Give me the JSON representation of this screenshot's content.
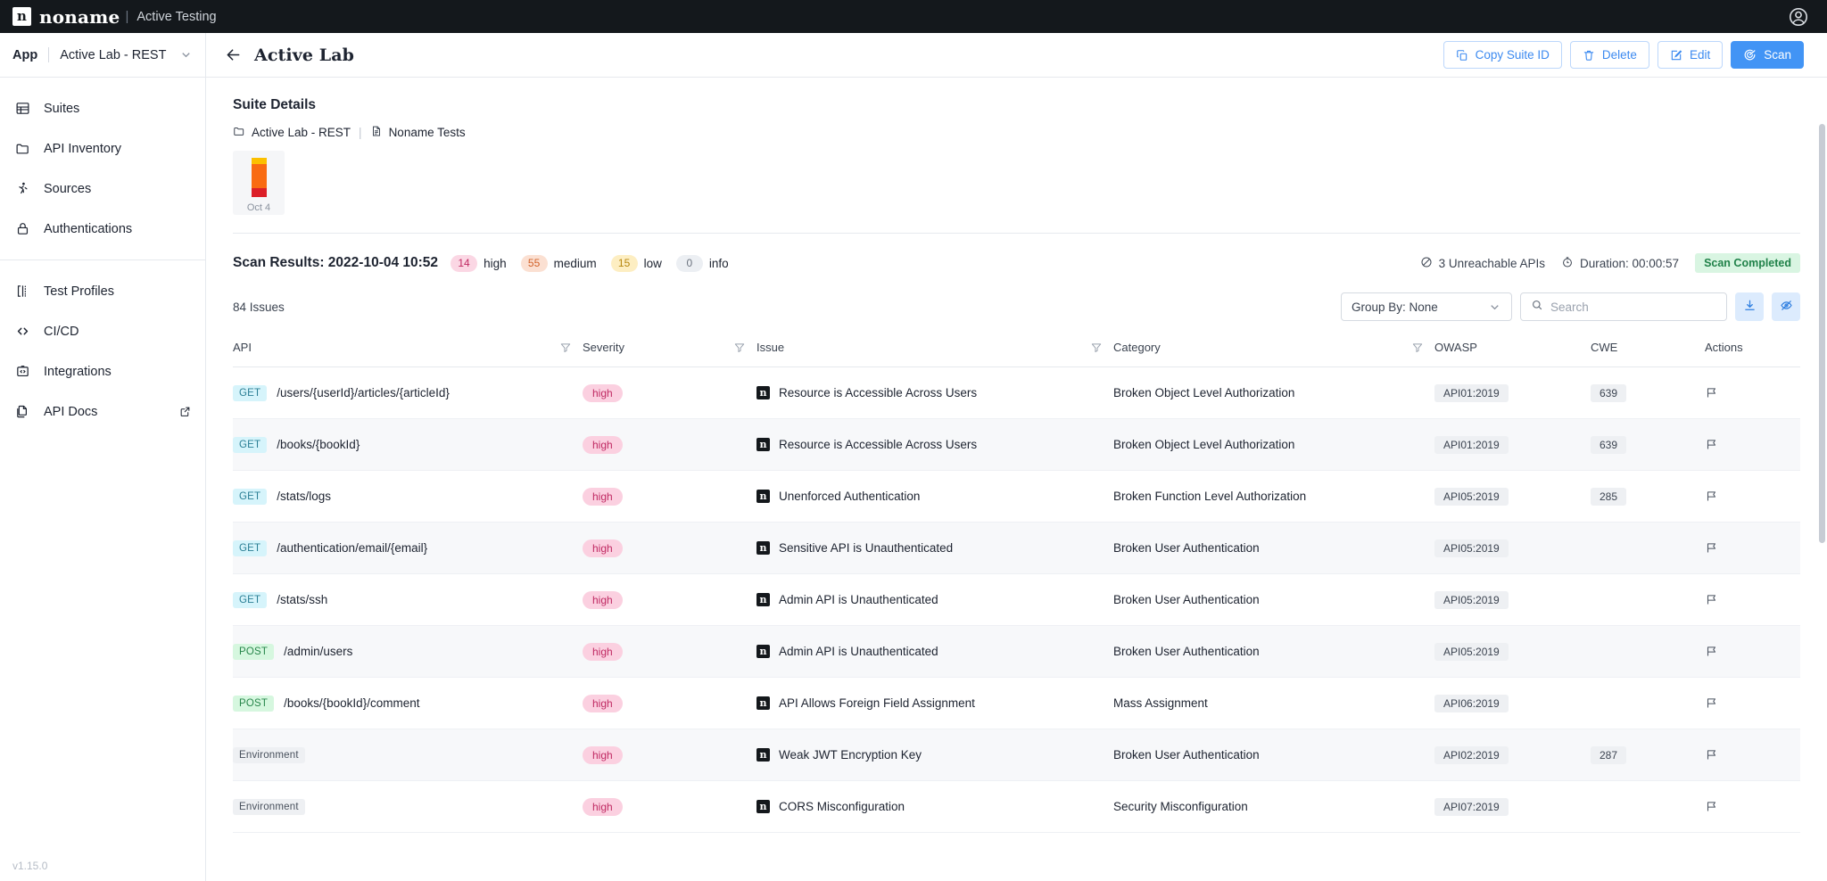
{
  "topbar": {
    "brand_mark": "n",
    "brand_name": "noname",
    "separator": "|",
    "subtitle": "Active Testing",
    "avatar_icon": "user-circle-icon"
  },
  "sidebar": {
    "app_label": "App",
    "app_value": "Active Lab - REST",
    "version": "v1.15.0",
    "groups": [
      {
        "items": [
          {
            "label": "Suites",
            "icon": "suites-icon"
          },
          {
            "label": "API Inventory",
            "icon": "folder-icon"
          },
          {
            "label": "Sources",
            "icon": "person-walking-icon"
          },
          {
            "label": "Authentications",
            "icon": "lock-icon"
          }
        ]
      },
      {
        "items": [
          {
            "label": "Test Profiles",
            "icon": "test-profiles-icon"
          },
          {
            "label": "CI/CD",
            "icon": "code-brackets-icon"
          },
          {
            "label": "Integrations",
            "icon": "integrations-icon"
          },
          {
            "label": "API Docs",
            "icon": "documents-icon",
            "external": true
          }
        ]
      }
    ]
  },
  "page": {
    "back_icon": "arrow-left-icon",
    "title": "Active Lab",
    "actions": [
      {
        "label": "Copy Suite ID",
        "icon": "copy-icon",
        "primary": false
      },
      {
        "label": "Delete",
        "icon": "trash-icon",
        "primary": false
      },
      {
        "label": "Edit",
        "icon": "pencil-square-icon",
        "primary": false
      },
      {
        "label": "Scan",
        "icon": "scan-target-icon",
        "primary": true
      }
    ]
  },
  "suite_details": {
    "title": "Suite Details",
    "breadcrumb": [
      {
        "label": "Active Lab - REST",
        "icon": "folder-icon"
      },
      {
        "label": "Noname Tests",
        "icon": "document-icon"
      }
    ],
    "breadcrumb_separator": "|",
    "spark": {
      "date": "Oct 4",
      "segments": [
        {
          "name": "low",
          "color": "#fcc000",
          "pct": 16
        },
        {
          "name": "medium",
          "color": "#f96b12",
          "pct": 62
        },
        {
          "name": "high",
          "color": "#dc1f28",
          "pct": 22
        }
      ]
    }
  },
  "scan_results": {
    "title": "Scan Results: 2022-10-04 10:52",
    "severities": [
      {
        "count": "14",
        "label": "high",
        "key": "high"
      },
      {
        "count": "55",
        "label": "medium",
        "key": "medium"
      },
      {
        "count": "15",
        "label": "low",
        "key": "low"
      },
      {
        "count": "0",
        "label": "info",
        "key": "info"
      }
    ],
    "unreachable": "3 Unreachable APIs",
    "unreachable_icon": "no-entry-icon",
    "duration": "Duration: 00:00:57",
    "duration_icon": "stopwatch-icon",
    "status": "Scan Completed",
    "status_color": "#21824a"
  },
  "toolbar": {
    "issues_count": "84 Issues",
    "group_by": "Group By: None",
    "search_placeholder": "Search",
    "search_value": "",
    "search_icon": "search-icon",
    "download_icon": "download-icon",
    "hide_icon": "eye-off-icon"
  },
  "table": {
    "columns": [
      {
        "key": "api",
        "label": "API",
        "filter": true
      },
      {
        "key": "severity",
        "label": "Severity",
        "filter": true
      },
      {
        "key": "issue",
        "label": "Issue",
        "filter": true
      },
      {
        "key": "category",
        "label": "Category",
        "filter": true
      },
      {
        "key": "owasp",
        "label": "OWASP",
        "filter": false
      },
      {
        "key": "cwe",
        "label": "CWE",
        "filter": false
      },
      {
        "key": "actions",
        "label": "Actions",
        "filter": false
      }
    ],
    "rows": [
      {
        "method": "GET",
        "path": "/users/{userId}/articles/{articleId}",
        "severity": "high",
        "issue": "Resource is Accessible Across Users",
        "category": "Broken Object Level Authorization",
        "owasp": "API01:2019",
        "cwe": "639"
      },
      {
        "method": "GET",
        "path": "/books/{bookId}",
        "severity": "high",
        "issue": "Resource is Accessible Across Users",
        "category": "Broken Object Level Authorization",
        "owasp": "API01:2019",
        "cwe": "639"
      },
      {
        "method": "GET",
        "path": "/stats/logs",
        "severity": "high",
        "issue": "Unenforced Authentication",
        "category": "Broken Function Level Authorization",
        "owasp": "API05:2019",
        "cwe": "285"
      },
      {
        "method": "GET",
        "path": "/authentication/email/{email}",
        "severity": "high",
        "issue": "Sensitive API is Unauthenticated",
        "category": "Broken User Authentication",
        "owasp": "API05:2019",
        "cwe": ""
      },
      {
        "method": "GET",
        "path": "/stats/ssh",
        "severity": "high",
        "issue": "Admin API is Unauthenticated",
        "category": "Broken User Authentication",
        "owasp": "API05:2019",
        "cwe": ""
      },
      {
        "method": "POST",
        "path": "/admin/users",
        "severity": "high",
        "issue": "Admin API is Unauthenticated",
        "category": "Broken User Authentication",
        "owasp": "API05:2019",
        "cwe": ""
      },
      {
        "method": "POST",
        "path": "/books/{bookId}/comment",
        "severity": "high",
        "issue": "API Allows Foreign Field Assignment",
        "category": "Mass Assignment",
        "owasp": "API06:2019",
        "cwe": ""
      },
      {
        "method": "ENV",
        "path": "",
        "method_label": "Environment",
        "severity": "high",
        "issue": "Weak JWT Encryption Key",
        "category": "Broken User Authentication",
        "owasp": "API02:2019",
        "cwe": "287"
      },
      {
        "method": "ENV",
        "path": "",
        "method_label": "Environment",
        "severity": "high",
        "issue": "CORS Misconfiguration",
        "category": "Security Misconfiguration",
        "owasp": "API07:2019",
        "cwe": ""
      }
    ],
    "flag_icon": "flag-icon",
    "issue_mark": "n"
  }
}
